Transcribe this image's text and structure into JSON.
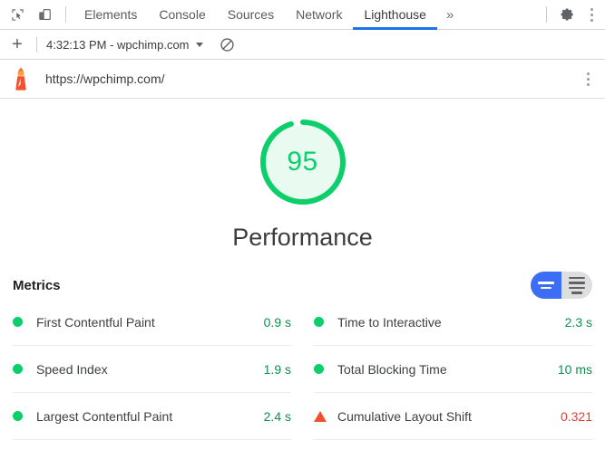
{
  "devtools_toolbar": {
    "inspect_icon": "inspect-element-icon",
    "device_icon": "device-toolbar-icon",
    "tabs": [
      {
        "label": "Elements",
        "active": false
      },
      {
        "label": "Console",
        "active": false
      },
      {
        "label": "Sources",
        "active": false
      },
      {
        "label": "Network",
        "active": false
      },
      {
        "label": "Lighthouse",
        "active": true
      }
    ],
    "overflow_label": "»",
    "settings_icon": "gear-icon",
    "more_icon": "more-vertical-icon"
  },
  "lighthouse_toolbar": {
    "add_label": "+",
    "run_select_label": "4:32:13 PM - wpchimp.com",
    "clear_icon": "clear-all-icon"
  },
  "url_bar": {
    "logo_icon": "lighthouse-logo-icon",
    "url": "https://wpchimp.com/",
    "menu_icon": "kebab-menu-icon"
  },
  "report": {
    "gauge": {
      "score": "95",
      "score_value": 95,
      "title": "Performance",
      "arc_color": "#0cce6b",
      "fill_color": "#e9fbf1"
    },
    "metrics": {
      "title": "Metrics",
      "toggle": {
        "simple_view": "simple-view-toggle",
        "detail_view": "detail-view-toggle",
        "active": "simple",
        "active_color": "#3b6ef5",
        "inactive_color": "#dedede"
      },
      "columns": [
        {
          "rows": [
            {
              "label": "First Contentful Paint",
              "value": "0.9 s",
              "status": "pass",
              "marker": "circle"
            },
            {
              "label": "Speed Index",
              "value": "1.9 s",
              "status": "pass",
              "marker": "circle"
            },
            {
              "label": "Largest Contentful Paint",
              "value": "2.4 s",
              "status": "pass",
              "marker": "circle"
            }
          ]
        },
        {
          "rows": [
            {
              "label": "Time to Interactive",
              "value": "2.3 s",
              "status": "pass",
              "marker": "circle"
            },
            {
              "label": "Total Blocking Time",
              "value": "10 ms",
              "status": "pass",
              "marker": "circle"
            },
            {
              "label": "Cumulative Layout Shift",
              "value": "0.321",
              "status": "fail",
              "marker": "triangle"
            }
          ]
        }
      ]
    }
  }
}
